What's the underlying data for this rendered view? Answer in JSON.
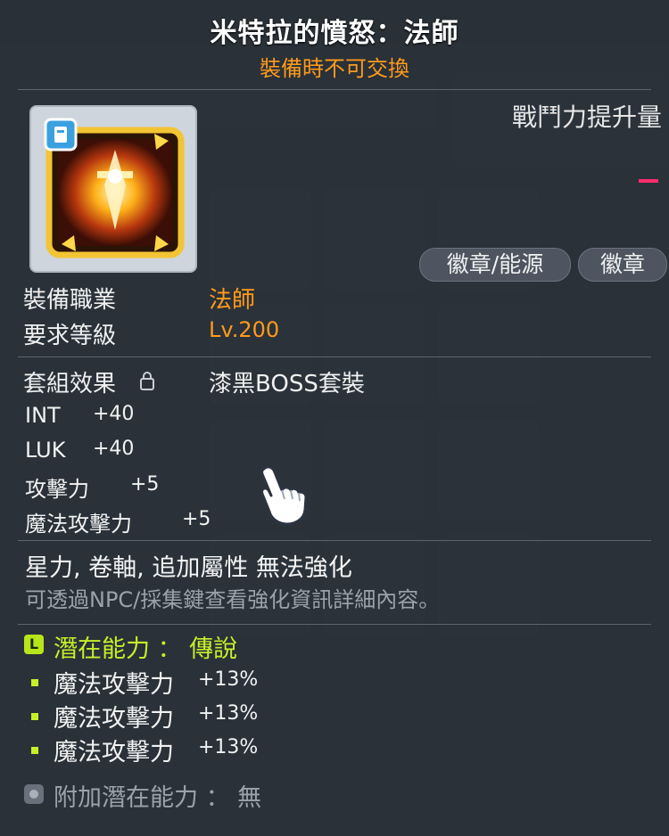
{
  "item": {
    "name": "米特拉的憤怒：法師",
    "trade_note": "裝備時不可交換",
    "icon": "mitra-emblem-icon"
  },
  "side_panel": {
    "combat_label": "戰鬥力提升量",
    "tabs": [
      "徽章/能源",
      "徽章"
    ]
  },
  "requirements": {
    "job_label": "裝備職業",
    "job_value": "法師",
    "level_label": "要求等級",
    "level_value": "Lv.200"
  },
  "set_effect": {
    "label": "套組效果",
    "value": "漆黑BOSS套裝"
  },
  "stats": [
    {
      "name": "INT",
      "value": "+40"
    },
    {
      "name": "LUK",
      "value": "+40"
    },
    {
      "name": "攻擊力",
      "value": "+5"
    },
    {
      "name": "魔法攻擊力",
      "value": "+5"
    }
  ],
  "notes": {
    "enhance_disabled": "星力, 卷軸, 追加屬性 無法強化",
    "npc_hint": "可透過NPC/採集鍵查看強化資訊詳細內容。"
  },
  "potential": {
    "badge": "L",
    "title": "潛在能力 ： 傳說",
    "lines": [
      {
        "name": "魔法攻擊力",
        "value": "+13%"
      },
      {
        "name": "魔法攻擊力",
        "value": "+13%"
      },
      {
        "name": "魔法攻擊力",
        "value": "+13%"
      }
    ]
  },
  "additional_potential": {
    "text": "附加潛在能力 ： 無"
  },
  "colors": {
    "accent_orange": "#ff9a1c",
    "legendary_green": "#c6f02a",
    "hint_gray": "#9aa2ab"
  }
}
